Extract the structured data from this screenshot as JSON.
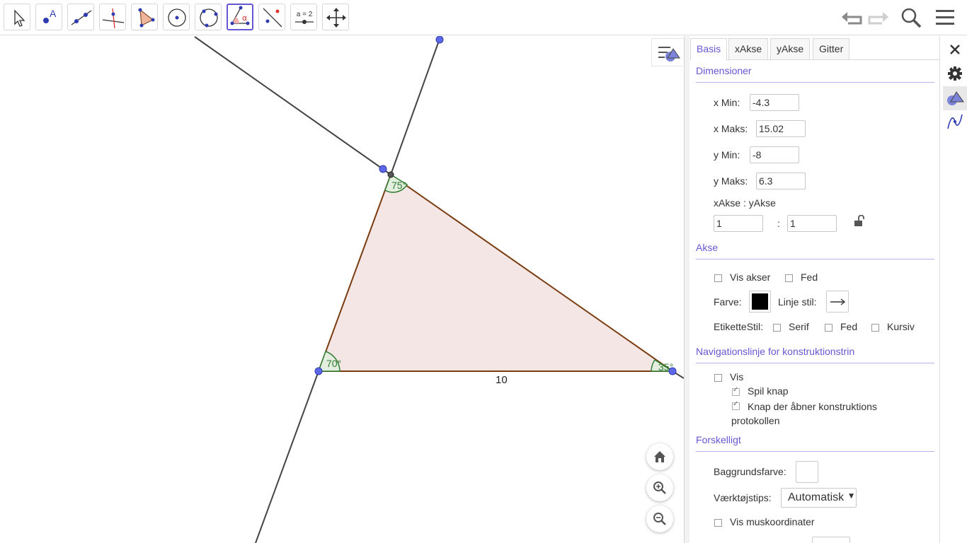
{
  "toolbar": {
    "tools": [
      {
        "name": "move-tool-icon"
      },
      {
        "name": "point-tool-icon",
        "glyph": "A"
      },
      {
        "name": "line-tool-icon"
      },
      {
        "name": "perpendicular-tool-icon"
      },
      {
        "name": "polygon-tool-icon"
      },
      {
        "name": "circle-center-tool-icon"
      },
      {
        "name": "circle-three-points-tool-icon"
      },
      {
        "name": "angle-tool-icon",
        "glyph": "α"
      },
      {
        "name": "reflect-tool-icon"
      },
      {
        "name": "slider-tool-icon",
        "glyph": "a = 2"
      },
      {
        "name": "move-graphics-view-icon"
      }
    ],
    "active_tool": "angle-tool-icon",
    "right_icons": [
      "undo-icon",
      "redo-icon",
      "search-icon",
      "menu-icon"
    ]
  },
  "graphics": {
    "angles": {
      "top": "75°",
      "left": "70°",
      "right": "35°"
    },
    "side_label": "10",
    "colors": {
      "triangle_fill": "#f5e6e6",
      "triangle_stroke": "#7a3c10",
      "angle_arc": "#2e7d32",
      "point": "#5c68e6",
      "line": "#444444"
    }
  },
  "panel": {
    "tabs": [
      "Basis",
      "xAkse",
      "yAkse",
      "Gitter"
    ],
    "active_tab": "Basis",
    "dimensions": {
      "title": "Dimensioner",
      "xmin_label": "x Min:",
      "xmin_value": "-4.3",
      "xmax_label": "x Maks:",
      "xmax_value": "15.02",
      "ymin_label": "y Min:",
      "ymin_value": "-8",
      "ymax_label": "y Maks:",
      "ymax_value": "6.3",
      "ratio_label": "xAkse : yAkse",
      "ratio_x": "1",
      "ratio_sep": ":",
      "ratio_y": "1"
    },
    "axes": {
      "title": "Akse",
      "show_axes": "Vis akser",
      "bold": "Fed",
      "color_label": "Farve:",
      "line_style_label": "Linje stil:",
      "label_style": "EtiketteStil:",
      "serif": "Serif",
      "bold2": "Fed",
      "italic": "Kursiv"
    },
    "navigation": {
      "title": "Navigationslinje for konstruktionstrin",
      "show": "Vis",
      "play_button": "Spil knap",
      "open_protocol": "Knap der åbner konstruktions protokollen"
    },
    "misc": {
      "title": "Forskelligt",
      "background_color": "Baggrundsfarve:",
      "tooltips": "Værktøjstips:",
      "tooltips_value": "Automatisk",
      "show_mouse_coords": "Vis muskoordinater"
    }
  }
}
